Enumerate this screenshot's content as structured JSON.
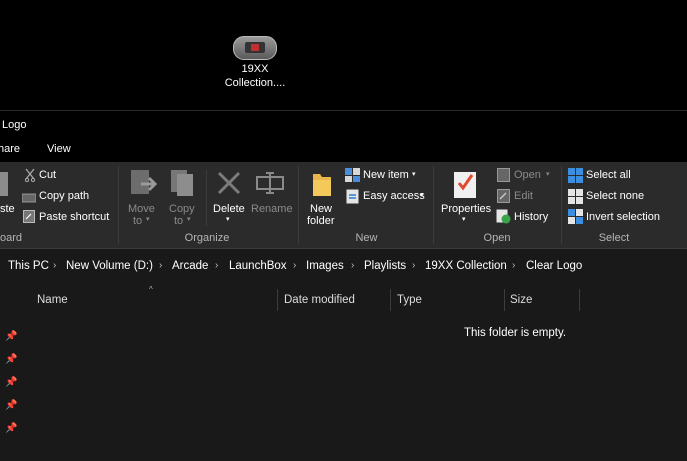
{
  "desktop": {
    "icon_label_line1": "19XX",
    "icon_label_line2": "Collection...."
  },
  "window": {
    "title": "Logo"
  },
  "tabs": [
    "hare",
    "View"
  ],
  "ribbon": {
    "clipboard": {
      "cut": "Cut",
      "copy_path": "Copy path",
      "paste_shortcut": "Paste shortcut",
      "paste": "ste",
      "group": "oard"
    },
    "organize": {
      "move_to_1": "Move",
      "move_to_2": "to",
      "copy_to_1": "Copy",
      "copy_to_2": "to",
      "delete": "Delete",
      "rename": "Rename",
      "group": "Organize"
    },
    "new": {
      "new_folder_1": "New",
      "new_folder_2": "folder",
      "new_item": "New item",
      "easy_access": "Easy access",
      "group": "New"
    },
    "open": {
      "properties": "Properties",
      "open": "Open",
      "edit": "Edit",
      "history": "History",
      "group": "Open"
    },
    "select": {
      "select_all": "Select all",
      "select_none": "Select none",
      "invert_selection": "Invert selection",
      "group": "Select"
    }
  },
  "breadcrumb": [
    "This PC",
    "New Volume (D:)",
    "Arcade",
    "LaunchBox",
    "Images",
    "Playlists",
    "19XX Collection",
    "Clear Logo"
  ],
  "columns": {
    "name": "Name",
    "date_modified": "Date modified",
    "type": "Type",
    "size": "Size"
  },
  "empty_message": "This folder is empty.",
  "colors": {
    "window_bg": "#191919",
    "ribbon_bg": "#2b2b2b",
    "titlebar_bg": "#000000",
    "accent_blue": "#2a7bd5"
  }
}
